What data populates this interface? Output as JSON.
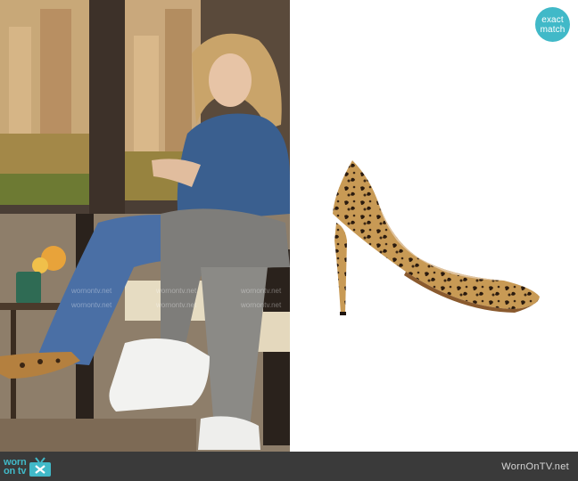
{
  "badge": {
    "line1": "exact",
    "line2": "match"
  },
  "footer": {
    "logo_line1": "worn",
    "logo_line2": "on tv",
    "site": "WornOnTV.net"
  },
  "watermark": {
    "text": "wornontv.net"
  },
  "colors": {
    "accent": "#41b9c8",
    "footer_bg": "#3a3a3a",
    "site_text": "#d7d7d7"
  },
  "icons": {
    "logo": "tv-icon",
    "product": "leopard-pump-icon"
  }
}
